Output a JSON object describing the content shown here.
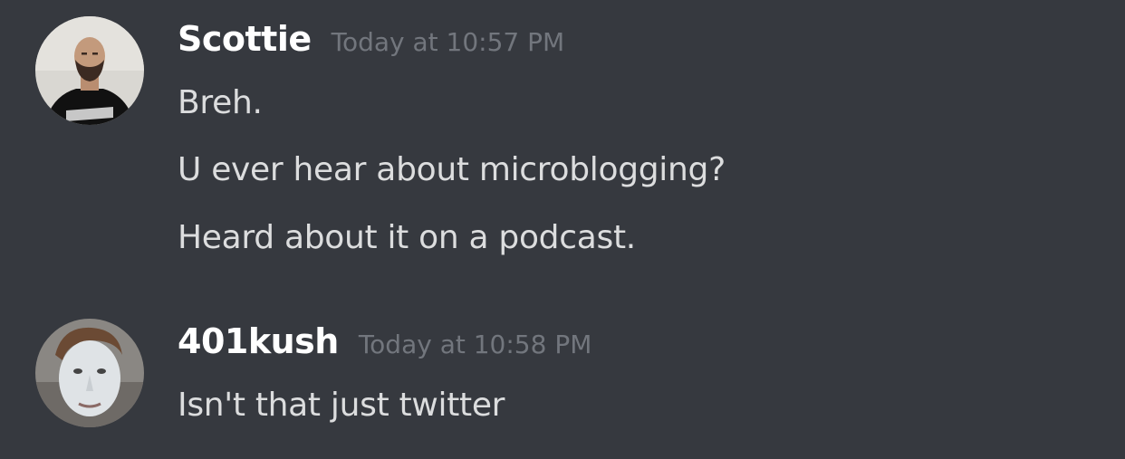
{
  "messages": [
    {
      "username": "Scottie",
      "timestamp": "Today at 10:57 PM",
      "avatar_icon": "bald-bearded-man-avatar",
      "lines": [
        "Breh.",
        "U ever hear about microblogging?",
        "Heard about it on a podcast."
      ]
    },
    {
      "username": "401kush",
      "timestamp": "Today at 10:58 PM",
      "avatar_icon": "pale-face-man-avatar",
      "lines": [
        "Isn't that just twitter"
      ]
    }
  ],
  "colors": {
    "background": "#36393f",
    "username": "#ffffff",
    "timestamp": "#72767d",
    "message_text": "#dcddde"
  }
}
